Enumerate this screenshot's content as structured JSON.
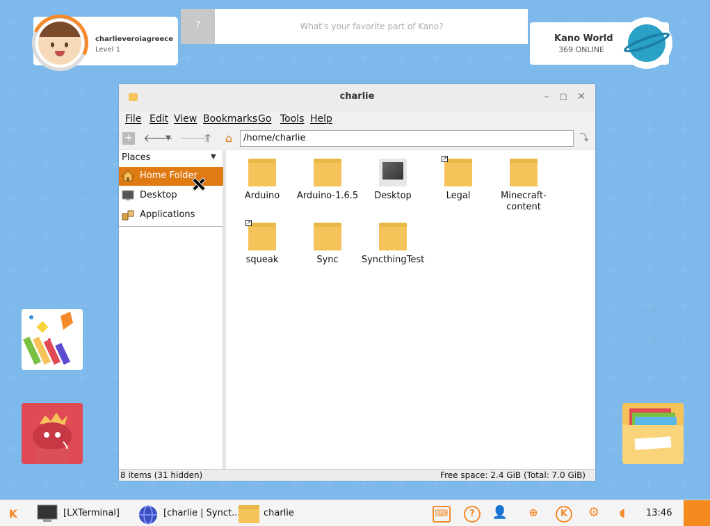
{
  "profile": {
    "username": "charlieveroiagreece",
    "level": "Level 1"
  },
  "question": {
    "mark": "?",
    "prompt": "What's your favorite part of Kano?"
  },
  "kano_world": {
    "title": "Kano World",
    "online": "369 ONLINE"
  },
  "window": {
    "title": "charlie",
    "menu": [
      "File",
      "Edit",
      "View",
      "Bookmarks",
      "Go",
      "Tools",
      "Help"
    ],
    "address": "/home/charlie",
    "places_header": "Places",
    "places": [
      {
        "label": "Home Folder",
        "icon": "home-icon",
        "active": true
      },
      {
        "label": "Desktop",
        "icon": "desktop-icon",
        "active": false
      },
      {
        "label": "Applications",
        "icon": "applications-icon",
        "active": false
      }
    ],
    "files": [
      {
        "name": "Arduino",
        "type": "folder"
      },
      {
        "name": "Arduino-1.6.5",
        "type": "folder"
      },
      {
        "name": "Desktop",
        "type": "desktop"
      },
      {
        "name": "Legal",
        "type": "folder-link"
      },
      {
        "name": "Minecraft-\ncontent",
        "type": "folder"
      },
      {
        "name": "squeak",
        "type": "folder-link"
      },
      {
        "name": "Sync",
        "type": "folder"
      },
      {
        "name": "SyncthingTest",
        "type": "folder"
      }
    ],
    "status_left": "8 items (31 hidden)",
    "status_right": "Free space: 2.4 GiB (Total: 7.0 GiB)"
  },
  "taskbar": {
    "k_label": "K",
    "tasks": [
      {
        "label": "[LXTerminal]",
        "icon": "terminal-icon"
      },
      {
        "label": "[charlie | Synct...",
        "icon": "browser-icon"
      },
      {
        "label": "charlie",
        "icon": "folder-icon"
      }
    ],
    "clock": "13:46"
  },
  "colors": {
    "accent": "#f58a2a",
    "desktop_bg": "#5aa3e0",
    "folder": "#f6c35a",
    "selection": "#e07a13"
  }
}
